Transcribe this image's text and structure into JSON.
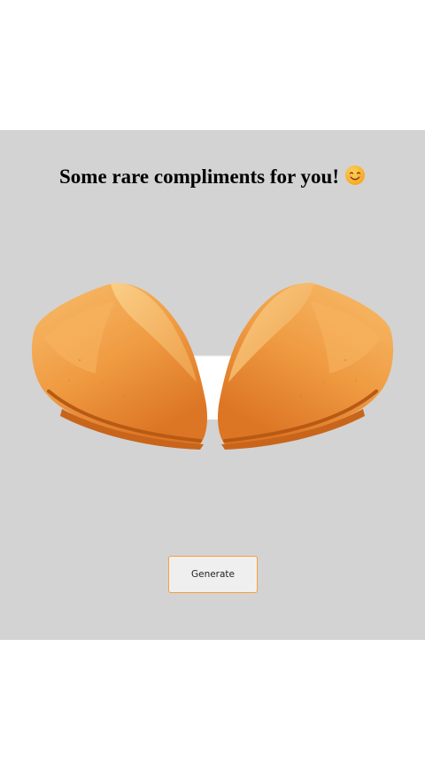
{
  "heading": {
    "text": "Some rare compliments for you!",
    "emoji_icon": "smiling-face-emoji"
  },
  "cookie": {
    "icon": "fortune-cookie-image",
    "colors": {
      "cookie_light": "#f6b15b",
      "cookie_mid": "#ee9a3f",
      "cookie_dark": "#d86f1e",
      "paper": "#ffffff"
    }
  },
  "actions": {
    "generate_label": "Generate"
  },
  "colors": {
    "panel_background": "#d3d3d3",
    "button_border": "#f5a03c"
  }
}
